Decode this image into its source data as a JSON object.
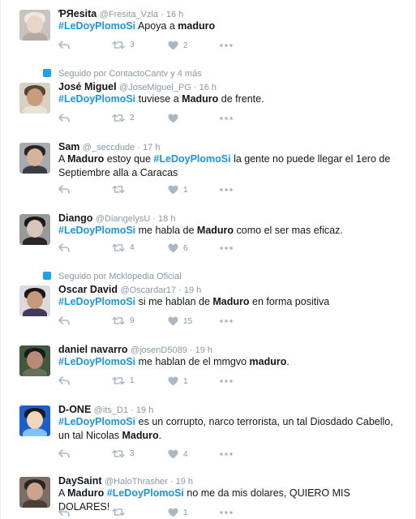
{
  "tweets": [
    {
      "name": "ƤЯesita",
      "handle": "@Fresita_Vzla",
      "time": "16 h",
      "body": [
        {
          "t": "#LeDoyPlomoSi",
          "k": "tag"
        },
        {
          "t": " Apoya a ",
          "k": ""
        },
        {
          "t": "maduro",
          "k": "b"
        }
      ],
      "retweets": "3",
      "likes": "2",
      "social": "",
      "colors": {
        "bg": "#c9c3c0",
        "face": "#e9d6c8",
        "hair": "#eee8e4",
        "body": "#b5a9a2"
      }
    },
    {
      "name": "José Miguel",
      "handle": "@JoseMiguel_PG",
      "time": "16 h",
      "body": [
        {
          "t": "#LeDoyPlomoSi",
          "k": "tag"
        },
        {
          "t": " tuviese a ",
          "k": ""
        },
        {
          "t": "Maduro",
          "k": "b"
        },
        {
          "t": " de frente.",
          "k": ""
        }
      ],
      "retweets": "2",
      "likes": "",
      "social": "Seguido por ContactoCantv y 4 más",
      "colors": {
        "bg": "#d9d2c4",
        "face": "#c99d7c",
        "hair": "#5a4634",
        "body": "#e8e2d8"
      }
    },
    {
      "name": "Sam",
      "handle": "@_seccdude",
      "time": "17 h",
      "body": [
        {
          "t": "A ",
          "k": ""
        },
        {
          "t": "Maduro",
          "k": "b"
        },
        {
          "t": " estoy que ",
          "k": ""
        },
        {
          "t": "#LeDoyPlomoSi",
          "k": "tag"
        },
        {
          "t": " la gente no puede llegar el 1ero de Septiembre alla a Caracas",
          "k": ""
        }
      ],
      "retweets": "",
      "likes": "1",
      "social": "",
      "colors": {
        "bg": "#a9a9b1",
        "face": "#d3b39a",
        "hair": "#2b2222",
        "body": "#3a3b45"
      }
    },
    {
      "name": "Diango",
      "handle": "@DiangelysU",
      "time": "18 h",
      "body": [
        {
          "t": "#LeDoyPlomoSi",
          "k": "tag"
        },
        {
          "t": " me habla de ",
          "k": ""
        },
        {
          "t": "Maduro",
          "k": "b"
        },
        {
          "t": " como el ser mas eficaz.",
          "k": ""
        }
      ],
      "retweets": "4",
      "likes": "6",
      "social": "",
      "colors": {
        "bg": "#9a9a9a",
        "face": "#d9c6bb",
        "hair": "#1f1a1a",
        "body": "#2a2626"
      }
    },
    {
      "name": "Oscar David",
      "handle": "@Oscardar17",
      "time": "19 h",
      "body": [
        {
          "t": "#LeDoyPlomoSi",
          "k": "tag"
        },
        {
          "t": " si me hablan de ",
          "k": ""
        },
        {
          "t": "Maduro",
          "k": "b"
        },
        {
          "t": " en forma positiva",
          "k": ""
        }
      ],
      "retweets": "9",
      "likes": "15",
      "social": "Seguido por Mcklopedia Oficial",
      "colors": {
        "bg": "#dcdadf",
        "face": "#c89a7c",
        "hair": "#1c1818",
        "body": "#3f3b5c"
      }
    },
    {
      "name": "daniel navarro",
      "handle": "@josenD5089",
      "time": "19 h",
      "body": [
        {
          "t": "#LeDoyPlomoSi",
          "k": "tag"
        },
        {
          "t": " me hablan de el mmgvo ",
          "k": ""
        },
        {
          "t": "maduro",
          "k": "b"
        },
        {
          "t": ".",
          "k": ""
        }
      ],
      "retweets": "1",
      "likes": "1",
      "social": "",
      "colors": {
        "bg": "#3f5a3a",
        "face": "#b98a78",
        "hair": "#1a1a1a",
        "body": "#6a6f5a"
      }
    },
    {
      "name": "D-ONE",
      "handle": "@its_D1",
      "time": "19 h",
      "body": [
        {
          "t": "#LeDoyPlomoSi",
          "k": "tag"
        },
        {
          "t": " es un corrupto, narco terrorista, un tal Diosdado Cabello, un tal Nicolas ",
          "k": ""
        },
        {
          "t": "Maduro",
          "k": "b"
        },
        {
          "t": ".",
          "k": ""
        }
      ],
      "retweets": "3",
      "likes": "4",
      "social": "",
      "colors": {
        "bg": "#1a5fd0",
        "face": "#f2d6b8",
        "hair": "#1a1a1a",
        "body": "#7dc3ff"
      }
    },
    {
      "name": "DaySaint",
      "handle": "@HaloThrasher",
      "time": "19 h",
      "body": [
        {
          "t": "A ",
          "k": ""
        },
        {
          "t": "Maduro",
          "k": "b"
        },
        {
          "t": " ",
          "k": ""
        },
        {
          "t": "#LeDoyPlomoSi",
          "k": "tag"
        },
        {
          "t": " no me da mis dolares, QUIERO MIS DOLARES!",
          "k": ""
        }
      ],
      "retweets": "",
      "likes": "1",
      "social": "",
      "colors": {
        "bg": "#7a6e66",
        "face": "#caa58e",
        "hair": "#2d2420",
        "body": "#4a403a"
      }
    }
  ]
}
